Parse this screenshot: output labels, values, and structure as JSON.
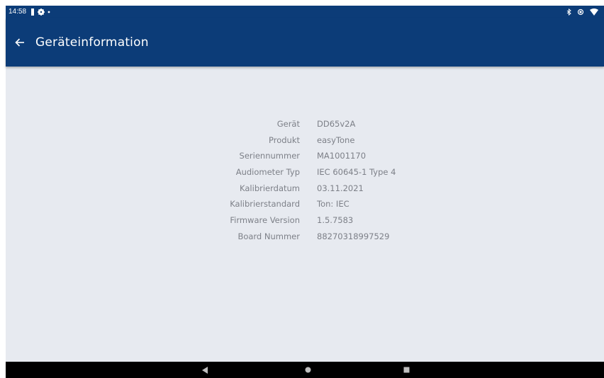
{
  "status_bar": {
    "time": "14:58",
    "left_icons": [
      "battery-saver-icon",
      "settings-icon",
      "notification-dot-icon"
    ],
    "right_icons": [
      "bluetooth-icon",
      "rotation-lock-icon",
      "wifi-icon"
    ]
  },
  "app_bar": {
    "title": "Geräteinformation",
    "back_icon": "arrow-left-icon",
    "background": "#0c3c78"
  },
  "device_info": [
    {
      "label": "Gerät",
      "value": "DD65v2A"
    },
    {
      "label": "Produkt",
      "value": "easyTone"
    },
    {
      "label": "Seriennummer",
      "value": "MA1001170"
    },
    {
      "label": "Audiometer Typ",
      "value": "IEC 60645-1 Type 4"
    },
    {
      "label": "Kalibrierdatum",
      "value": "03.11.2021"
    },
    {
      "label": "Kalibrierstandard",
      "value": "Ton: IEC"
    },
    {
      "label": "Firmware Version",
      "value": "1.5.7583"
    },
    {
      "label": "Board Nummer",
      "value": "88270318997529"
    }
  ],
  "nav_bar": {
    "buttons": [
      "back-triangle-icon",
      "home-circle-icon",
      "recents-square-icon"
    ]
  }
}
